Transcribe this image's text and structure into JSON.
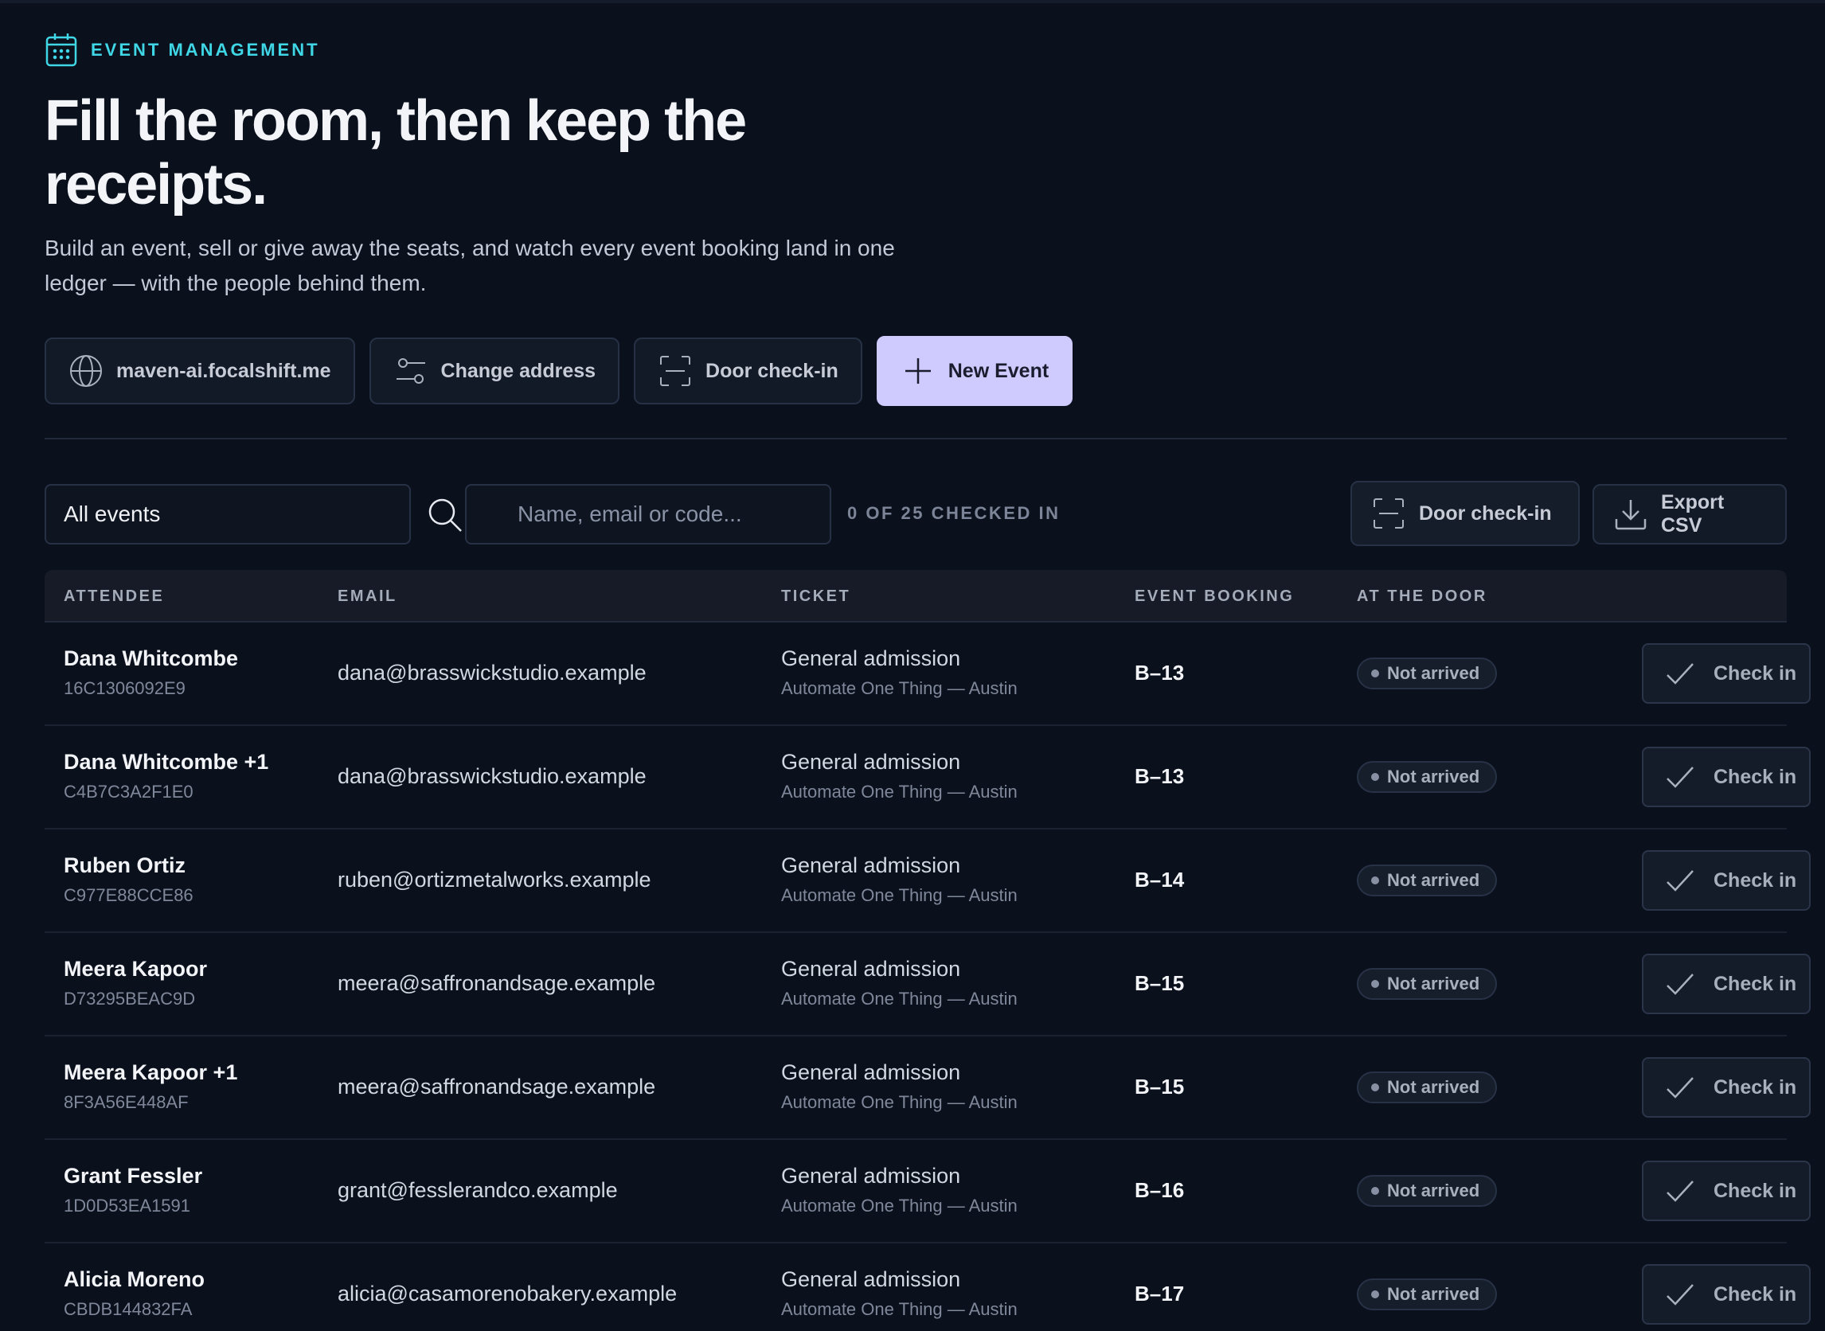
{
  "header": {
    "eyebrow": "EVENT MANAGEMENT",
    "title": "Fill the room, then keep the receipts.",
    "subtitle": "Build an event, sell or give away the seats, and watch every event booking land in one ledger — with the people behind them."
  },
  "actions": {
    "domain_label": "maven-ai.focalshift.me",
    "change_address_label": "Change address",
    "door_checkin_label": "Door check-in",
    "new_event_label": "New Event"
  },
  "toolbar": {
    "event_filter_value": "All events",
    "search_placeholder": "Name, email or code...",
    "checked_in_count": "0 OF 25 CHECKED IN",
    "door_checkin_label": "Door check-in",
    "export_label": "Export CSV"
  },
  "table": {
    "columns": [
      "ATTENDEE",
      "EMAIL",
      "TICKET",
      "EVENT BOOKING",
      "AT THE DOOR"
    ],
    "check_in_label": "Check in",
    "rows": [
      {
        "name": "Dana Whitcombe",
        "code": "16C1306092E9",
        "email": "dana@brasswickstudio.example",
        "ticket": "General admission",
        "event": "Automate One Thing — Austin",
        "booking": "B–13",
        "status": "Not arrived"
      },
      {
        "name": "Dana Whitcombe +1",
        "code": "C4B7C3A2F1E0",
        "email": "dana@brasswickstudio.example",
        "ticket": "General admission",
        "event": "Automate One Thing — Austin",
        "booking": "B–13",
        "status": "Not arrived"
      },
      {
        "name": "Ruben Ortiz",
        "code": "C977E88CCE86",
        "email": "ruben@ortizmetalworks.example",
        "ticket": "General admission",
        "event": "Automate One Thing — Austin",
        "booking": "B–14",
        "status": "Not arrived"
      },
      {
        "name": "Meera Kapoor",
        "code": "D73295BEAC9D",
        "email": "meera@saffronandsage.example",
        "ticket": "General admission",
        "event": "Automate One Thing — Austin",
        "booking": "B–15",
        "status": "Not arrived"
      },
      {
        "name": "Meera Kapoor +1",
        "code": "8F3A56E448AF",
        "email": "meera@saffronandsage.example",
        "ticket": "General admission",
        "event": "Automate One Thing — Austin",
        "booking": "B–15",
        "status": "Not arrived"
      },
      {
        "name": "Grant Fessler",
        "code": "1D0D53EA1591",
        "email": "grant@fesslerandco.example",
        "ticket": "General admission",
        "event": "Automate One Thing — Austin",
        "booking": "B–16",
        "status": "Not arrived"
      },
      {
        "name": "Alicia Moreno",
        "code": "CBDB144832FA",
        "email": "alicia@casamorenobakery.example",
        "ticket": "General admission",
        "event": "Automate One Thing — Austin",
        "booking": "B–17",
        "status": "Not arrived"
      }
    ]
  }
}
